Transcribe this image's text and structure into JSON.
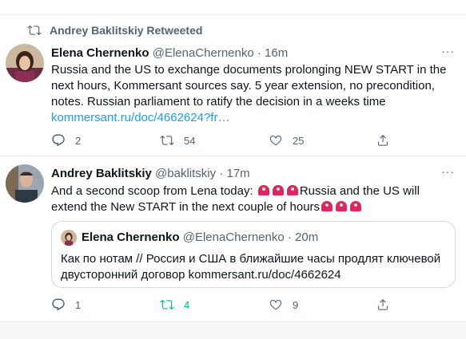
{
  "tweets": [
    {
      "retweeted_by": "Andrey Baklitskiy Retweeted",
      "author_name": "Elena Chernenko",
      "author_handle": "@ElenaChernenko",
      "time": "16m",
      "text": "Russia and the US to exchange documents prolonging NEW START in the next hours, Kommersant sources say. 5 year extension, no precondition, notes. Russian parliament to ratify the decision in a weeks time",
      "link": "kommersant.ru/doc/4662624?fr…",
      "counts": {
        "replies": "2",
        "retweets": "54",
        "likes": "25"
      }
    },
    {
      "author_name": "Andrey Baklitskiy",
      "author_handle": "@baklitskiy",
      "time": "17m",
      "text_part1": "And a second scoop from Lena today:",
      "text_part2": "Russia and the US will extend the New START in the next couple of hours",
      "quote": {
        "author_name": "Elena Chernenko",
        "author_handle": "@ElenaChernenko",
        "time": "20m",
        "text": "Как по нотам // Россия и США в ближайшие часы продлят ключевой двусторонний договор kommersant.ru/doc/4662624"
      },
      "counts": {
        "replies": "1",
        "retweets": "4",
        "likes": "9"
      }
    }
  ],
  "colors": {
    "accent": "#1d9bf0",
    "retweet_active": "#00ba7c",
    "muted": "#536471"
  },
  "icons": [
    "retweet-icon",
    "reply-icon",
    "like-icon",
    "share-icon",
    "more-icon",
    "siren-emoji"
  ]
}
